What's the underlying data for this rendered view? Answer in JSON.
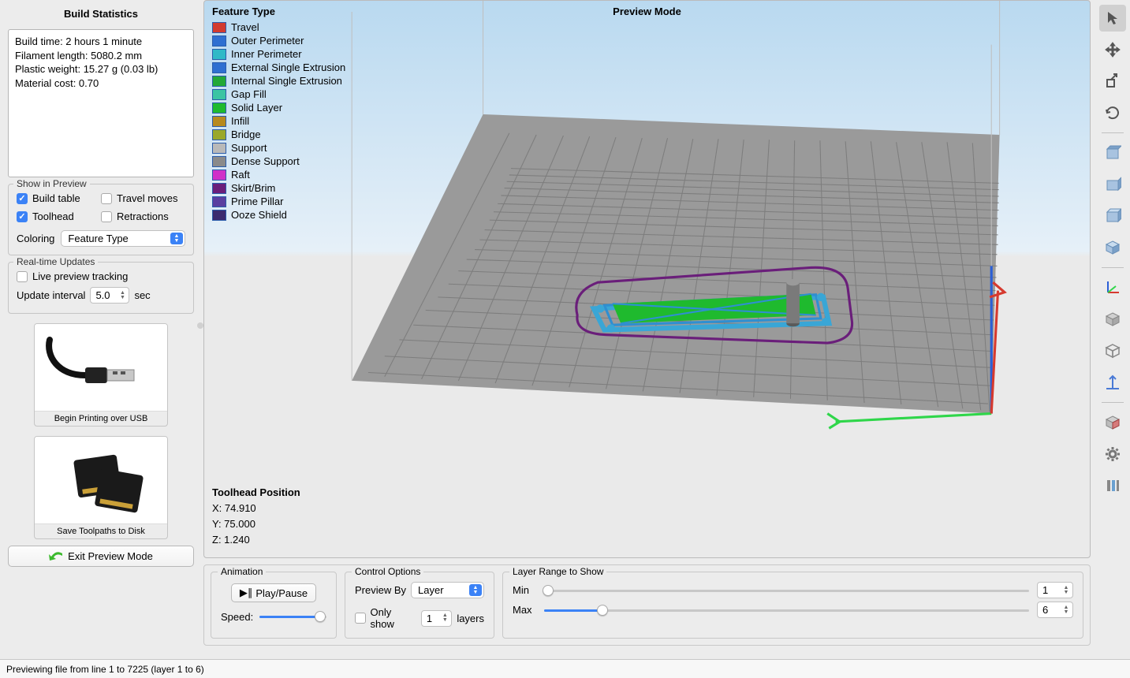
{
  "sidebar": {
    "stats_title": "Build Statistics",
    "stats_lines": [
      "Build time: 2 hours 1 minute",
      "Filament length: 5080.2 mm",
      "Plastic weight: 15.27 g (0.03 lb)",
      "Material cost: 0.70"
    ],
    "show_in_preview": {
      "legend": "Show in Preview",
      "build_table": {
        "label": "Build table",
        "checked": true
      },
      "travel_moves": {
        "label": "Travel moves",
        "checked": false
      },
      "toolhead": {
        "label": "Toolhead",
        "checked": true
      },
      "retractions": {
        "label": "Retractions",
        "checked": false
      },
      "coloring_label": "Coloring",
      "coloring_value": "Feature Type"
    },
    "realtime": {
      "legend": "Real-time Updates",
      "live_preview": {
        "label": "Live preview tracking",
        "checked": false
      },
      "interval_label": "Update interval",
      "interval_value": "5.0",
      "interval_unit": "sec"
    },
    "usb_card": "Begin Printing over USB",
    "disk_card": "Save Toolpaths to Disk",
    "exit_button": "Exit Preview Mode"
  },
  "viewport": {
    "preview_mode": "Preview Mode",
    "legend_title": "Feature Type",
    "legend": [
      {
        "color": "#d23a2f",
        "label": "Travel"
      },
      {
        "color": "#2f6fd1",
        "label": "Outer Perimeter"
      },
      {
        "color": "#2fb9c7",
        "label": "Inner Perimeter"
      },
      {
        "color": "#2f6fd1",
        "label": "External Single Extrusion"
      },
      {
        "color": "#23a837",
        "label": "Internal Single Extrusion"
      },
      {
        "color": "#3bc4a3",
        "label": "Gap Fill"
      },
      {
        "color": "#1fba2e",
        "label": "Solid Layer"
      },
      {
        "color": "#b78a1f",
        "label": "Infill"
      },
      {
        "color": "#9aa82a",
        "label": "Bridge"
      },
      {
        "color": "#b9b9b9",
        "label": "Support"
      },
      {
        "color": "#8a8a8a",
        "label": "Dense Support"
      },
      {
        "color": "#d030c8",
        "label": "Raft"
      },
      {
        "color": "#6a1e7a",
        "label": "Skirt/Brim"
      },
      {
        "color": "#5a3fa0",
        "label": "Prime Pillar"
      },
      {
        "color": "#3c2a6e",
        "label": "Ooze Shield"
      }
    ],
    "toolhead_title": "Toolhead Position",
    "toolhead_x": "X: 74.910",
    "toolhead_y": "Y: 75.000",
    "toolhead_z": "Z: 1.240"
  },
  "bottom": {
    "anim": {
      "legend": "Animation",
      "play": "Play/Pause",
      "speed_label": "Speed:"
    },
    "ctrl": {
      "legend": "Control Options",
      "preview_by_label": "Preview By",
      "preview_by_value": "Layer",
      "only_show_label": "Only show",
      "only_show_value": "1",
      "layers_label": "layers",
      "only_show_checked": false
    },
    "range": {
      "legend": "Layer Range to Show",
      "min_label": "Min",
      "max_label": "Max",
      "min_value": "1",
      "max_value": "6"
    }
  },
  "status": "Previewing file from line 1 to 7225 (layer 1 to 6)"
}
